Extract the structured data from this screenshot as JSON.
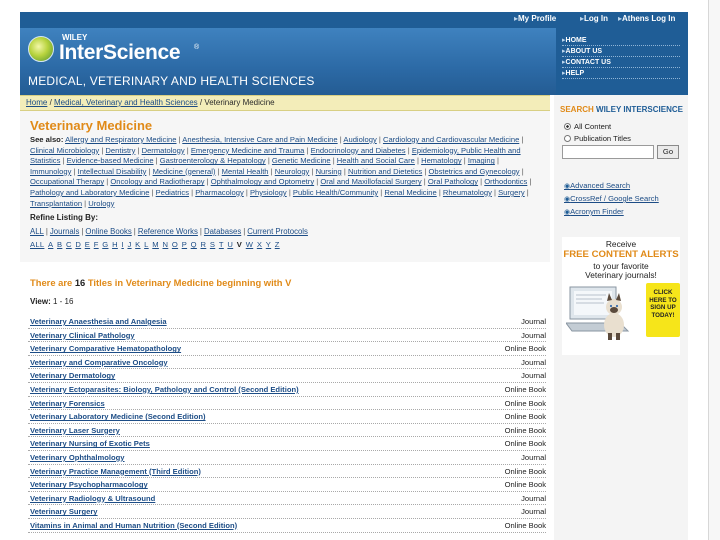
{
  "topbar": {
    "links": [
      "My Profile",
      "Log In",
      "Athens Log In"
    ]
  },
  "header": {
    "publisher": "WILEY",
    "brand": "InterScience",
    "brand_mark": "®",
    "section_title": "MEDICAL, VETERINARY AND HEALTH SCIENCES",
    "right_links": [
      "HOME",
      "ABOUT US",
      "CONTACT US",
      "HELP"
    ]
  },
  "breadcrumb": {
    "home": "Home",
    "sep": " / ",
    "parent": "Medical, Veterinary and Health Sciences",
    "current": "Veterinary Medicine"
  },
  "main": {
    "title": "Veterinary Medicine",
    "see_also_label": "See also:",
    "subjects": [
      "Allergy and Respiratory Medicine",
      "Anesthesia, Intensive Care and Pain Medicine",
      "Audiology",
      "Cardiology and Cardiovascular Medicine",
      "Clinical Microbiology",
      "Dentistry",
      "Dermatology",
      "Emergency Medicine and Trauma",
      "Endocrinology and Diabetes",
      "Epidemiology, Public Health and Statistics",
      "Evidence-based Medicine",
      "Gastroenterology & Hepatology",
      "Genetic Medicine",
      "Health and Social Care",
      "Hematology",
      "Imaging",
      "Immunology",
      "Intellectual Disability",
      "Medicine (general)",
      "Mental Health",
      "Neurology",
      "Nursing",
      "Nutrition and Dietetics",
      "Obstetrics and Gynecology",
      "Occupational Therapy",
      "Oncology and Radiotherapy",
      "Ophthalmology and Optometry",
      "Oral and Maxillofacial Surgery",
      "Oral Pathology",
      "Orthodontics",
      "Pathology and Laboratory Medicine",
      "Pediatrics",
      "Pharmacology",
      "Physiology",
      "Public Health/Community",
      "Renal Medicine",
      "Rheumatology",
      "Surgery",
      "Transplantation",
      "Urology"
    ],
    "refine_label": "Refine Listing By:",
    "refine_options": [
      "ALL",
      "Journals",
      "Online Books",
      "Reference Works",
      "Databases",
      "Current Protocols"
    ],
    "alpha": [
      "ALL",
      "A",
      "B",
      "C",
      "D",
      "E",
      "F",
      "G",
      "H",
      "I",
      "J",
      "K",
      "L",
      "M",
      "N",
      "O",
      "P",
      "Q",
      "R",
      "S",
      "T",
      "U",
      "V",
      "W",
      "X",
      "Y",
      "Z"
    ],
    "count_prefix": "There are",
    "count": "16",
    "count_suffix": "Titles in Veterinary Medicine beginning with V",
    "view_label": "View:",
    "view_range": "1 - 16",
    "titles": [
      {
        "title": "Veterinary Anaesthesia and Analgesia",
        "kind": "Journal"
      },
      {
        "title": "Veterinary Clinical Pathology",
        "kind": "Journal"
      },
      {
        "title": "Veterinary Comparative Hematopathology",
        "kind": "Online Book"
      },
      {
        "title": "Veterinary and Comparative Oncology",
        "kind": "Journal"
      },
      {
        "title": "Veterinary Dermatology",
        "kind": "Journal"
      },
      {
        "title": "Veterinary Ectoparasites: Biology, Pathology and Control (Second Edition)",
        "kind": "Online Book"
      },
      {
        "title": "Veterinary Forensics",
        "kind": "Online Book"
      },
      {
        "title": "Veterinary Laboratory Medicine (Second Edition)",
        "kind": "Online Book"
      },
      {
        "title": "Veterinary Laser Surgery",
        "kind": "Online Book"
      },
      {
        "title": "Veterinary Nursing of Exotic Pets",
        "kind": "Online Book"
      },
      {
        "title": "Veterinary Ophthalmology",
        "kind": "Journal"
      },
      {
        "title": "Veterinary Practice Management (Third Edition)",
        "kind": "Online Book"
      },
      {
        "title": "Veterinary Psychopharmacology",
        "kind": "Online Book"
      },
      {
        "title": "Veterinary Radiology & Ultrasound",
        "kind": "Journal"
      },
      {
        "title": "Veterinary Surgery",
        "kind": "Journal"
      },
      {
        "title": "Vitamins in Animal and Human Nutrition (Second Edition)",
        "kind": "Online Book"
      }
    ]
  },
  "sidebar": {
    "search_word": "SEARCH",
    "search_brand": "WILEY INTERSCIENCE",
    "radio_all": "All Content",
    "radio_pub": "Publication Titles",
    "go": "Go",
    "search_value": "",
    "links": [
      "Advanced Search",
      "CrossRef / Google Search",
      "Acronym Finder"
    ],
    "ad": {
      "line1": "Receive",
      "line2": "FREE CONTENT ALERTS",
      "line3": "to your favorite",
      "line4": "Veterinary journals!",
      "cta": [
        "CLICK",
        "HERE TO",
        "SIGN UP",
        "TODAY!"
      ]
    }
  },
  "colors": {
    "brand_blue": "#1f5d96",
    "accent_orange": "#e08a18",
    "link_blue": "#1d4d86",
    "breadcrumb_bg": "#f3edb9"
  }
}
